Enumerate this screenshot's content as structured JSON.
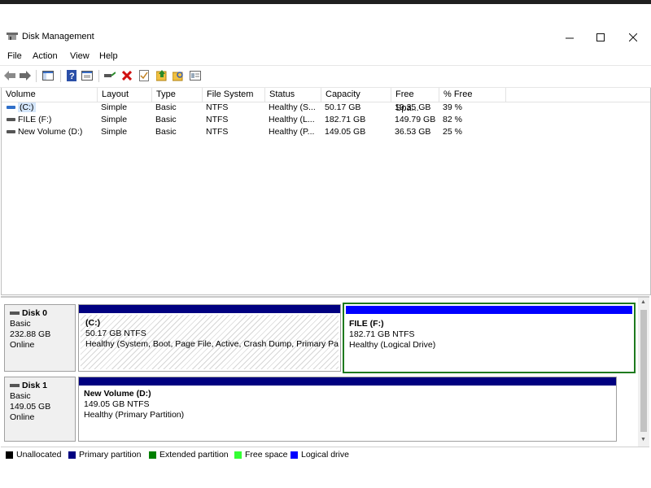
{
  "window": {
    "title": "Disk Management"
  },
  "menu": [
    "File",
    "Action",
    "View",
    "Help"
  ],
  "toolbar": {
    "icons": [
      "back-arrow-icon",
      "forward-arrow-icon",
      "console-tree-icon",
      "help-icon",
      "properties-icon",
      "connect-disk-icon",
      "delete-icon",
      "check-icon",
      "folder-up-icon",
      "search-folder-icon",
      "settings-icon"
    ]
  },
  "list": {
    "columns": [
      "Volume",
      "Layout",
      "Type",
      "File System",
      "Status",
      "Capacity",
      "Free Spa...",
      "% Free"
    ],
    "rows": [
      {
        "volume": "(C:)",
        "layout": "Simple",
        "type": "Basic",
        "fs": "NTFS",
        "status": "Healthy (S...",
        "capacity": "50.17 GB",
        "free": "19.35 GB",
        "pct": "39 %"
      },
      {
        "volume": "FILE (F:)",
        "layout": "Simple",
        "type": "Basic",
        "fs": "NTFS",
        "status": "Healthy (L...",
        "capacity": "182.71 GB",
        "free": "149.79 GB",
        "pct": "82 %"
      },
      {
        "volume": "New Volume (D:)",
        "layout": "Simple",
        "type": "Basic",
        "fs": "NTFS",
        "status": "Healthy (P...",
        "capacity": "149.05 GB",
        "free": "36.53 GB",
        "pct": "25 %"
      }
    ]
  },
  "disks": [
    {
      "name": "Disk 0",
      "type": "Basic",
      "size": "232.88 GB",
      "state": "Online",
      "partitions": [
        {
          "title": "(C:)",
          "size": "50.17 GB NTFS",
          "status": "Healthy (System, Boot, Page File, Active, Crash Dump, Primary Pa"
        },
        {
          "title": "FILE  (F:)",
          "size": "182.71 GB NTFS",
          "status": "Healthy (Logical Drive)"
        }
      ]
    },
    {
      "name": "Disk 1",
      "type": "Basic",
      "size": "149.05 GB",
      "state": "Online",
      "partitions": [
        {
          "title": "New Volume  (D:)",
          "size": "149.05 GB NTFS",
          "status": "Healthy (Primary Partition)"
        }
      ]
    }
  ],
  "legend": [
    {
      "label": "Unallocated",
      "color": "#000000"
    },
    {
      "label": "Primary partition",
      "color": "#000080"
    },
    {
      "label": "Extended partition",
      "color": "#008000"
    },
    {
      "label": "Free space",
      "color": "#33ff33"
    },
    {
      "label": "Logical drive",
      "color": "#0000ff"
    }
  ],
  "colors": {
    "primary_bar": "#000080",
    "logical_bar": "#0000ff",
    "extended_border": "#1e7a1e"
  }
}
